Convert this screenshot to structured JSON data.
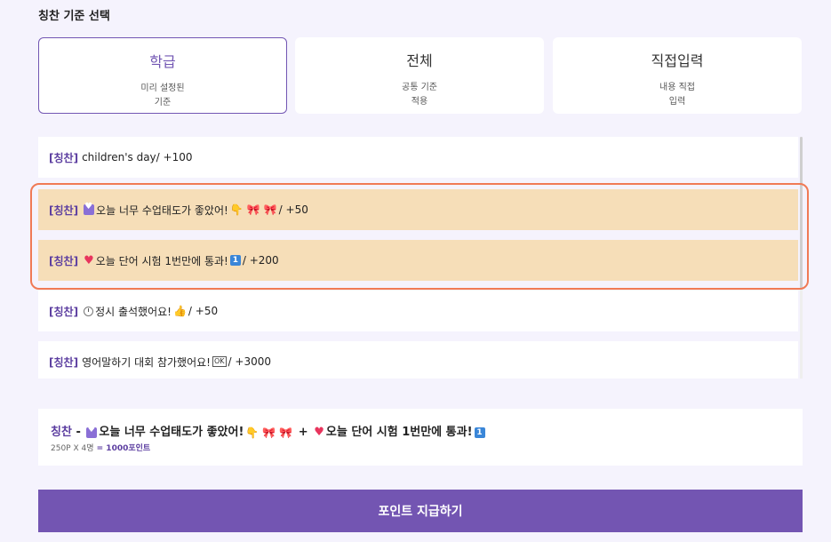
{
  "section_title": "칭찬 기준 선택",
  "options": [
    {
      "title": "학급",
      "desc1": "미리 설정된",
      "desc2": "기준",
      "selected": true
    },
    {
      "title": "전체",
      "desc1": "공통 기준",
      "desc2": "적용",
      "selected": false
    },
    {
      "title": "직접입력",
      "desc1": "내용 직접",
      "desc2": "입력",
      "selected": false
    }
  ],
  "tag": "[칭찬]",
  "items": [
    {
      "pre": "",
      "text": "children's day",
      "points": " / +100"
    },
    {
      "pre": "",
      "text": "오늘 너무 수업태도가 좋았어!",
      "points": " / +50"
    },
    {
      "pre": "",
      "text": "오늘 단어 시험 1번만에 통과!",
      "points": " / +200"
    },
    {
      "pre": "",
      "text": "정시 출석했어요!",
      "points": " / +50"
    },
    {
      "pre": "",
      "text": "영어말하기 대회 참가했어요!",
      "points": " / +3000"
    }
  ],
  "summary": {
    "tag": "칭찬",
    "dash": " - ",
    "part1": "오늘 너무 수업태도가 좋았어!",
    "plus": " + ",
    "part2": "오늘 단어 시험 1번만에 통과!",
    "calc": "250P X 4명",
    "total": " = 1000포인트"
  },
  "submit_label": "포인트 지급하기",
  "icons": [
    "heart-box-icon",
    "pointing-hand-icon",
    "ribbon-icon",
    "heart-icon",
    "keycap-one-icon",
    "clock-icon",
    "thumbs-up-icon",
    "ok-icon"
  ],
  "colors": {
    "accent": "#7355b2",
    "selected_item": "#f6deb8",
    "highlight": "#f07a55"
  }
}
